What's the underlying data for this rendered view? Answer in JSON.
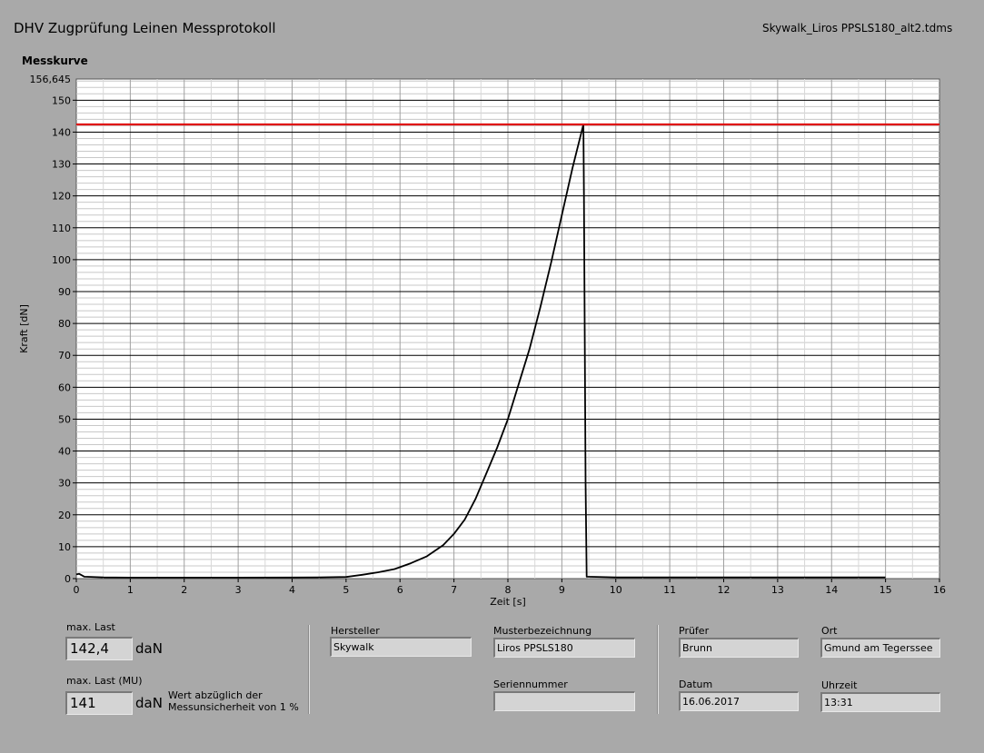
{
  "header": {
    "title": "DHV Zugprüfung Leinen Messprotokoll",
    "filename": "Skywalk_Liros PPSLS180_alt2.tdms",
    "chart_label": "Messkurve"
  },
  "chart_data": {
    "type": "line",
    "xlabel": "Zeit [s]",
    "ylabel": "Kraft [dN]",
    "xlim": [
      0,
      16
    ],
    "ylim": [
      0,
      156.645
    ],
    "ylim_label": "156,645",
    "xticks": [
      "0",
      "1",
      "2",
      "3",
      "4",
      "5",
      "6",
      "7",
      "8",
      "9",
      "10",
      "11",
      "12",
      "13",
      "14",
      "15",
      "16"
    ],
    "yticks": [
      "0",
      "10",
      "20",
      "30",
      "40",
      "50",
      "60",
      "70",
      "80",
      "90",
      "100",
      "110",
      "120",
      "130",
      "140",
      "150"
    ],
    "grid": true,
    "series": [
      {
        "color": "#000000",
        "x": [
          0,
          0.05,
          0.15,
          0.5,
          1,
          2,
          3,
          4,
          4.5,
          5,
          5.3,
          5.6,
          5.9,
          6.2,
          6.5,
          6.8,
          7.0,
          7.2,
          7.4,
          7.6,
          7.8,
          8.0,
          8.2,
          8.4,
          8.6,
          8.8,
          9.0,
          9.2,
          9.4,
          9.41,
          9.44,
          9.46,
          10,
          11,
          12,
          13,
          14,
          15
        ],
        "y": [
          1.3,
          1.5,
          0.6,
          0.4,
          0.3,
          0.3,
          0.3,
          0.35,
          0.4,
          0.5,
          1.2,
          2.0,
          3.0,
          4.8,
          7.0,
          10.5,
          14.0,
          18.5,
          25.0,
          33.0,
          41.0,
          50.0,
          61.0,
          72.0,
          85.0,
          99.0,
          114.0,
          129.0,
          142.4,
          120.0,
          30.0,
          0.6,
          0.4,
          0.4,
          0.4,
          0.4,
          0.4,
          0.4
        ]
      },
      {
        "color": "#e01010",
        "x": [
          0,
          16
        ],
        "y": [
          142.4,
          142.4
        ]
      }
    ]
  },
  "results": {
    "max_label": "max. Last",
    "max_value": "142,4",
    "max_unit": "daN",
    "mu_label": "max. Last (MU)",
    "mu_value": "141",
    "mu_unit": "daN",
    "mu_note_line1": "Wert abzüglich der",
    "mu_note_line2": "Messunsicherheit von 1 %"
  },
  "info": {
    "hersteller_label": "Hersteller",
    "hersteller": "Skywalk",
    "muster_label": "Musterbezeichnung",
    "muster": "Liros PPSLS180",
    "serie_label": "Seriennummer",
    "serie": "",
    "pruefer_label": "Prüfer",
    "pruefer": "Brunn",
    "ort_label": "Ort",
    "ort": "Gmund am Tegerssee",
    "datum_label": "Datum",
    "datum": "16.06.2017",
    "uhrzeit_label": "Uhrzeit",
    "uhrzeit": "13:31"
  }
}
